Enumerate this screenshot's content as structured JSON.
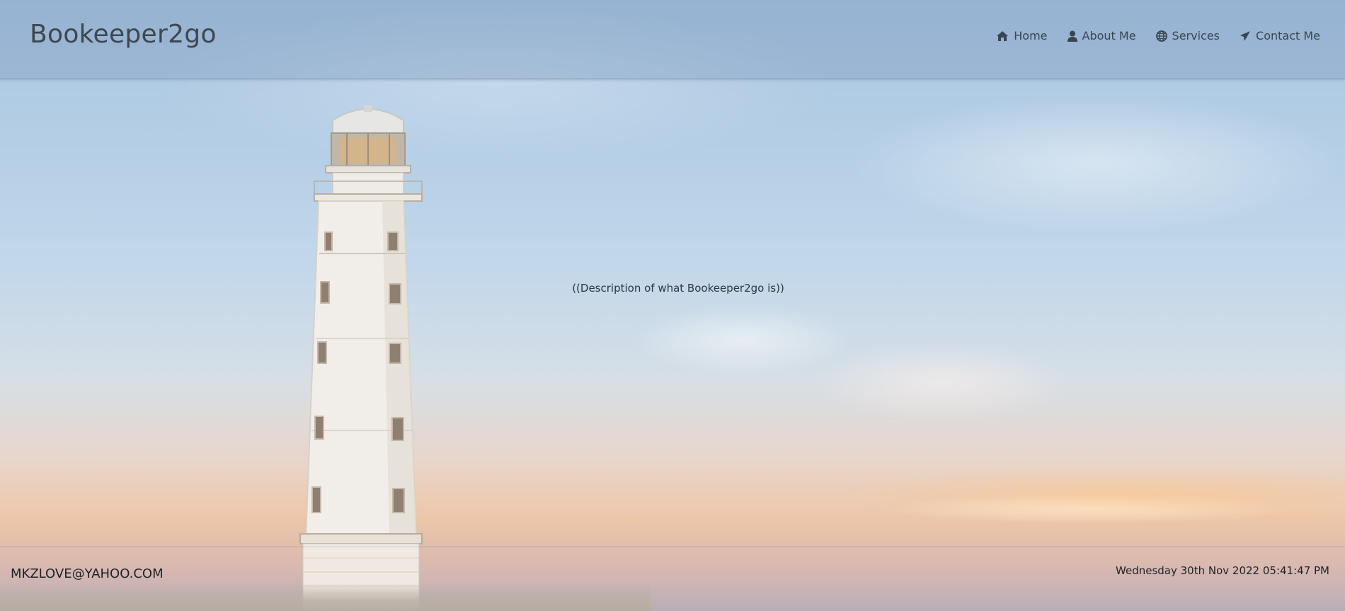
{
  "header": {
    "brand": "Bookeeper2go",
    "nav": [
      {
        "label": "Home",
        "icon": "home-icon"
      },
      {
        "label": "About Me",
        "icon": "user-icon"
      },
      {
        "label": "Services",
        "icon": "globe-icon"
      },
      {
        "label": "Contact Me",
        "icon": "paper-plane-icon"
      }
    ]
  },
  "main": {
    "description": "((Description of what Bookeeper2go is))"
  },
  "footer": {
    "email": "MKZLOVE@YAHOO.COM",
    "datetime": "Wednesday 30th Nov 2022 05:41:47 PM"
  },
  "colors": {
    "header_text": "#3e4750",
    "body_text": "#2e3640"
  }
}
